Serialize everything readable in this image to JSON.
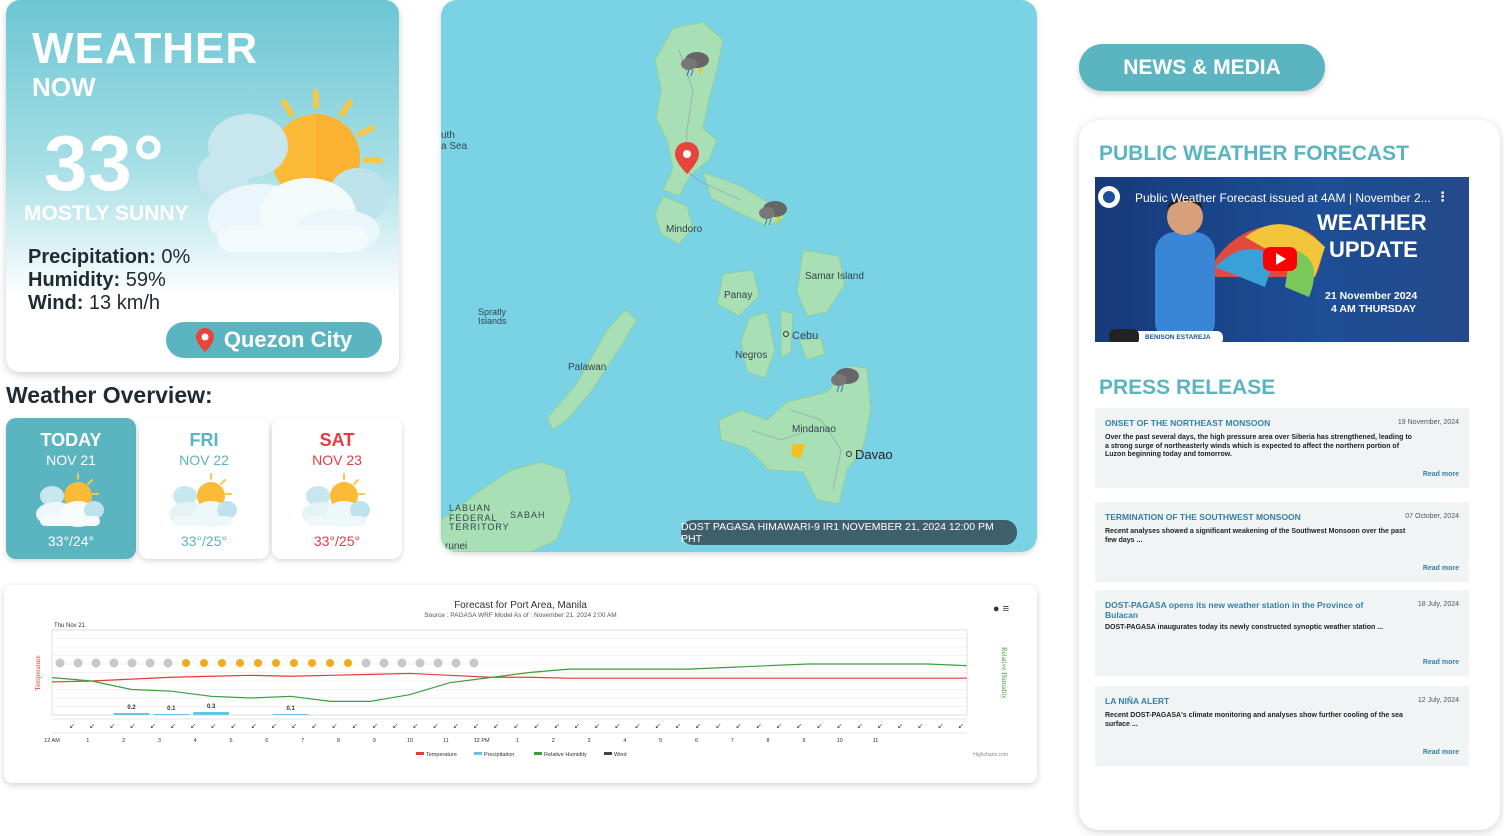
{
  "weather_now": {
    "title": "WEATHER",
    "subtitle": "NOW",
    "temperature": "33°",
    "condition": "MOSTLY SUNNY",
    "precipitation_label": "Precipitation:",
    "precipitation_value": " 0%",
    "humidity_label": "Humidity:",
    "humidity_value": " 59%",
    "wind_label": "Wind:",
    "wind_value": " 13 km/h",
    "location": "Quezon City",
    "icon": "sun-behind-cloud-icon"
  },
  "overview": {
    "title": "Weather Overview:",
    "days": [
      {
        "name": "TODAY",
        "date": "NOV 21",
        "range": "33°/24°",
        "icon": "partly-cloudy-icon"
      },
      {
        "name": "FRI",
        "date": "NOV 22",
        "range": "33°/25°",
        "icon": "partly-cloudy-icon"
      },
      {
        "name": "SAT",
        "date": "NOV 23",
        "range": "33°/25°",
        "icon": "partly-cloudy-icon"
      }
    ]
  },
  "map": {
    "caption": "DOST PAGASA HIMAWARI-9 IR1 NOVEMBER 21, 2024 12:00 PM PHT",
    "labels": {
      "south_sea": "uth\na Sea",
      "mindoro": "Mindoro",
      "samar": "Samar Island",
      "panay": "Panay",
      "cebu": "Cebu",
      "negros": "Negros",
      "spratly": "Spratly\nIslands",
      "palawan": "Palawan",
      "mindanao": "Mindanao",
      "davao": "Davao",
      "labuan": "LABUAN\nFEDERAL\nTERRITORY",
      "sabah": "SABAH",
      "brunei": "runei"
    }
  },
  "chart": {
    "title": "Forecast for Port Area, Manila",
    "source": "Source : PAGASA WRF Model        As of : November 21, 2024 2:00 AM",
    "date_label": "Thu Nov 21",
    "y_left_title": "Temperature",
    "y_right_title": "Relative Humidity",
    "credit": "Highcharts.com",
    "legend": {
      "temperature": "Temperature",
      "precipitation": "Precipitation",
      "humidity": "Relative Humidity",
      "wind": "Wind"
    },
    "x_ticks": [
      "12 AM",
      "1",
      "2",
      "3",
      "4",
      "5",
      "6",
      "7",
      "8",
      "9",
      "10",
      "11",
      "12 PM",
      "1",
      "2",
      "3",
      "4",
      "5",
      "6",
      "7",
      "8",
      "9",
      "10",
      "11"
    ],
    "precip_labels": [
      "0.2",
      "0.1",
      "0.3",
      "0.1"
    ],
    "colors": {
      "temperature": "#e53b32",
      "humidity": "#3a9e3a",
      "precipitation": "#65c3e5"
    }
  },
  "chart_data": {
    "type": "line",
    "title": "Forecast for Port Area, Manila",
    "xlabel": "",
    "ylabel": "Temperature",
    "categories": [
      "12 AM",
      "1",
      "2",
      "3",
      "4",
      "5",
      "6",
      "7",
      "8",
      "9",
      "10",
      "11",
      "12 PM",
      "1",
      "2",
      "3",
      "4",
      "5",
      "6",
      "7",
      "8",
      "9",
      "10",
      "11"
    ],
    "series": [
      {
        "name": "Temperature",
        "values": [
          24.5,
          24.6,
          24.8,
          25,
          25.1,
          25.2,
          25.1,
          25.2,
          25.3,
          25.4,
          25.2,
          25,
          25,
          24.9,
          24.9,
          24.9,
          24.9,
          24.9,
          24.9,
          24.9,
          24.9,
          24.9,
          24.9,
          24.9
        ]
      },
      {
        "name": "Relative Humidity",
        "values": [
          72,
          70,
          65,
          64,
          61,
          60,
          61,
          58,
          58,
          62,
          69,
          72,
          75,
          77,
          77,
          77,
          77,
          78,
          79,
          80,
          80,
          80,
          80,
          79
        ]
      },
      {
        "name": "Precipitation",
        "values": [
          0,
          0,
          0.2,
          0.1,
          0.3,
          0,
          0.1,
          0,
          0,
          0,
          0,
          0,
          0,
          0,
          0,
          0,
          0,
          0,
          0,
          0,
          0,
          0,
          0,
          0
        ]
      }
    ]
  },
  "news": {
    "button": "NEWS & MEDIA",
    "forecast_title": "PUBLIC WEATHER FORECAST",
    "video": {
      "title": "Public Weather Forecast issued at 4AM | November 2...",
      "headline1": "WEATHER",
      "headline2": "UPDATE",
      "date": "21 November 2024",
      "time": "4 AM  THURSDAY",
      "presenter": "BENISON ESTAREJA"
    },
    "press_title": "PRESS RELEASE",
    "press": [
      {
        "title": "ONSET OF THE NORTHEAST MONSOON",
        "date": "19 November, 2024",
        "body": "Over the past several days, the high pressure area over Siberia has strengthened, leading to a strong surge of northeasterly winds which is expected to affect the northern portion of Luzon beginning today and tomorrow.",
        "more": "Read more"
      },
      {
        "title": "TERMINATION OF THE SOUTHWEST MONSOON",
        "date": "07 October, 2024",
        "body": "Recent analyses showed a significant weakening of the Southwest Monsoon over the past few days ...",
        "more": "Read more"
      },
      {
        "title": "DOST-PAGASA opens its new weather station in the Province of Bulacan",
        "date": "18 July, 2024",
        "body": "DOST-PAGASA inaugurates today its newly constructed synoptic weather station ...",
        "more": "Read more"
      },
      {
        "title": "LA NIÑA ALERT",
        "date": "12 July, 2024",
        "body": "Recent DOST-PAGASA's climate monitoring and analyses show further cooling of the sea surface ...",
        "more": "Read more"
      }
    ]
  }
}
